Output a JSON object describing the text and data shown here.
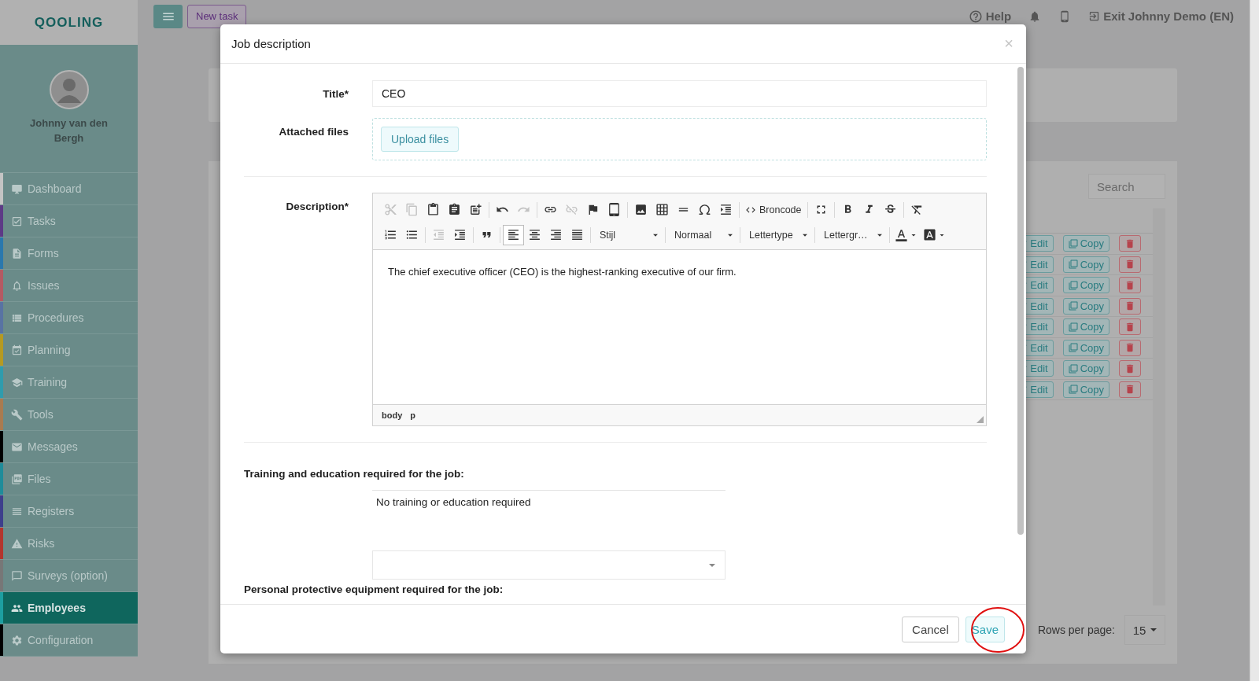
{
  "sidebar": {
    "logo": "QOOLING",
    "user": "Johnny van den Bergh",
    "items": [
      {
        "label": "Dashboard",
        "color": "#c4c4c4",
        "selected": false
      },
      {
        "label": "Tasks",
        "color": "#5d3a86",
        "selected": false
      },
      {
        "label": "Forms",
        "color": "#2a78ad",
        "selected": false
      },
      {
        "label": "Issues",
        "color": "#b45a63",
        "selected": false
      },
      {
        "label": "Procedures",
        "color": "#5873a3",
        "selected": false
      },
      {
        "label": "Planning",
        "color": "#b59a22",
        "selected": false
      },
      {
        "label": "Training",
        "color": "#2f9cad",
        "selected": false
      },
      {
        "label": "Tools",
        "color": "#a97b50",
        "selected": false
      },
      {
        "label": "Messages",
        "color": "#000000",
        "selected": false
      },
      {
        "label": "Files",
        "color": "#1f8c9a",
        "selected": false
      },
      {
        "label": "Registers",
        "color": "#3d3f8c",
        "selected": false
      },
      {
        "label": "Risks",
        "color": "#b3352e",
        "selected": false
      },
      {
        "label": "Surveys (option)",
        "color": "#777777",
        "selected": false
      },
      {
        "label": "Employees",
        "color": "#1d9ea0",
        "selected": true
      },
      {
        "label": "Configuration",
        "color": "#000000",
        "selected": false
      }
    ]
  },
  "topbar": {
    "new_task": "New task",
    "help": "Help",
    "exit": "Exit Johnny Demo (EN)"
  },
  "list": {
    "search": {
      "placeholder": "Search"
    },
    "rows": [
      {
        "edit": "Edit",
        "copy": "Copy"
      },
      {
        "edit": "Edit",
        "copy": "Copy"
      },
      {
        "edit": "Edit",
        "copy": "Copy"
      },
      {
        "edit": "Edit",
        "copy": "Copy"
      },
      {
        "edit": "Edit",
        "copy": "Copy"
      },
      {
        "edit": "Edit",
        "copy": "Copy"
      },
      {
        "edit": "Edit",
        "copy": "Copy"
      },
      {
        "edit": "Edit",
        "copy": "Copy"
      }
    ],
    "rows_per_page": {
      "label": "Rows per page:",
      "value": "15"
    }
  },
  "modal": {
    "title": "Job description",
    "close": "×",
    "title_field": {
      "label": "Title*",
      "value": "CEO"
    },
    "attached_files": {
      "label": "Attached files",
      "button": "Upload files"
    },
    "description": {
      "label": "Description*",
      "toolbar": {
        "upper": [
          {
            "buttons": [
              {
                "kind": "button",
                "disabled": true,
                "on": false
              },
              {
                "kind": "button",
                "disabled": true,
                "on": false
              },
              {
                "kind": "button",
                "disabled": false,
                "on": false
              },
              {
                "kind": "button",
                "disabled": false,
                "on": false
              },
              {
                "kind": "button",
                "disabled": false,
                "on": false
              }
            ]
          },
          {
            "buttons": [
              {
                "kind": "button",
                "disabled": false,
                "on": false
              },
              {
                "kind": "button",
                "disabled": true,
                "on": false
              }
            ]
          },
          {
            "buttons": [
              {
                "kind": "button",
                "disabled": false,
                "on": false
              },
              {
                "kind": "button",
                "disabled": true,
                "on": false
              },
              {
                "kind": "button",
                "disabled": false,
                "on": false
              },
              {
                "kind": "button",
                "disabled": false,
                "on": false
              }
            ]
          },
          {
            "buttons": [
              {
                "kind": "button",
                "disabled": false,
                "on": false
              },
              {
                "kind": "button",
                "disabled": false,
                "on": false
              },
              {
                "kind": "button",
                "disabled": false,
                "on": false
              },
              {
                "kind": "button",
                "disabled": false,
                "on": false
              },
              {
                "kind": "button",
                "disabled": false,
                "on": false
              }
            ]
          },
          {
            "buttons": [
              {
                "kind": "text",
                "label": "Broncode"
              }
            ]
          },
          {
            "buttons": [
              {
                "kind": "button",
                "disabled": false,
                "on": false
              }
            ]
          },
          {
            "buttons": [
              {
                "kind": "button",
                "disabled": false,
                "on": false
              },
              {
                "kind": "button",
                "disabled": false,
                "on": false
              },
              {
                "kind": "button",
                "disabled": false,
                "on": false
              }
            ]
          },
          {
            "buttons": [
              {
                "kind": "button",
                "disabled": false,
                "on": false
              }
            ]
          }
        ],
        "lower": [
          {
            "buttons": [
              {
                "kind": "button",
                "disabled": false,
                "on": false
              },
              {
                "kind": "button",
                "disabled": false,
                "on": false
              }
            ]
          },
          {
            "buttons": [
              {
                "kind": "button",
                "disabled": true,
                "on": false
              },
              {
                "kind": "button",
                "disabled": false,
                "on": false
              }
            ]
          },
          {
            "buttons": [
              {
                "kind": "button",
                "disabled": false,
                "on": false
              }
            ]
          },
          {
            "buttons": [
              {
                "kind": "button",
                "disabled": false,
                "on": true
              },
              {
                "kind": "button",
                "disabled": false,
                "on": false
              },
              {
                "kind": "button",
                "disabled": false,
                "on": false
              },
              {
                "kind": "button",
                "disabled": false,
                "on": false
              }
            ]
          },
          {
            "buttons": [
              {
                "kind": "dropdown",
                "label": "Stijl"
              }
            ]
          },
          {
            "buttons": [
              {
                "kind": "dropdown",
                "label": "Normaal"
              }
            ]
          },
          {
            "buttons": [
              {
                "kind": "dropdown",
                "label": "Lettertype"
              }
            ]
          },
          {
            "buttons": [
              {
                "kind": "dropdown",
                "label": "Lettergr…"
              }
            ]
          },
          {
            "buttons": [
              {
                "kind": "menu",
                "disabled": false,
                "on": false
              },
              {
                "kind": "menu",
                "disabled": false,
                "on": false
              }
            ]
          }
        ]
      },
      "content": "The chief executive officer (CEO) is the highest-ranking executive of our firm.",
      "path": [
        "body",
        "p"
      ]
    },
    "training": {
      "heading": "Training and education required for the job:",
      "items": [
        "No training or education required"
      ]
    },
    "ppe": {
      "heading": "Personal protective equipment required for the job:"
    },
    "buttons": {
      "cancel": "Cancel",
      "save": "Save"
    }
  }
}
